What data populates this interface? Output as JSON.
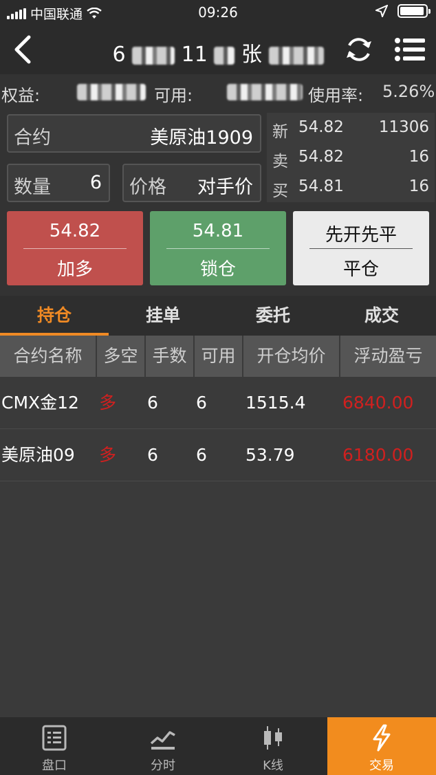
{
  "status_bar": {
    "carrier": "中国联通",
    "time": "09:26",
    "battery_level": 0.95
  },
  "navbar": {
    "title_visible_chars": [
      "6",
      "11",
      "张"
    ]
  },
  "account": {
    "equity_label": "权益:",
    "available_label": "可用:",
    "usage_label": "使用率:",
    "usage_value": "5.26%"
  },
  "order_form": {
    "contract_label": "合约",
    "contract_value": "美原油1909",
    "qty_label": "数量",
    "qty_value": "6",
    "price_label": "价格",
    "price_value": "对手价"
  },
  "quote": {
    "rows": [
      {
        "key": "新",
        "price": "54.82",
        "volume": "11306"
      },
      {
        "key": "卖",
        "price": "54.82",
        "volume": "16"
      },
      {
        "key": "买",
        "price": "54.81",
        "volume": "16"
      }
    ]
  },
  "actions": {
    "buy_price": "54.82",
    "buy_label": "加多",
    "lock_price": "54.81",
    "lock_label": "锁仓",
    "close_mode": "先开先平",
    "close_label": "平仓"
  },
  "tabs": [
    "持仓",
    "挂单",
    "委托",
    "成交"
  ],
  "positions": {
    "headers": [
      "合约名称",
      "多空",
      "手数",
      "可用",
      "开仓均价",
      "浮动盈亏"
    ],
    "rows": [
      {
        "name": "CMX金12",
        "side": "多",
        "qty": "6",
        "avail": "6",
        "avg_price": "1515.4",
        "pnl": "6840.00"
      },
      {
        "name": "美原油09",
        "side": "多",
        "qty": "6",
        "avail": "6",
        "avg_price": "53.79",
        "pnl": "6180.00"
      }
    ]
  },
  "bottom_tabs": [
    {
      "label": "盘口",
      "icon": "order-book-icon"
    },
    {
      "label": "分时",
      "icon": "timeshare-chart-icon"
    },
    {
      "label": "K线",
      "icon": "candlestick-icon"
    },
    {
      "label": "交易",
      "icon": "lightning-icon"
    }
  ],
  "colors": {
    "accent": "#f28c1e",
    "buy": "#c0504d",
    "lock": "#5ea06a",
    "profit": "#d0201f"
  }
}
